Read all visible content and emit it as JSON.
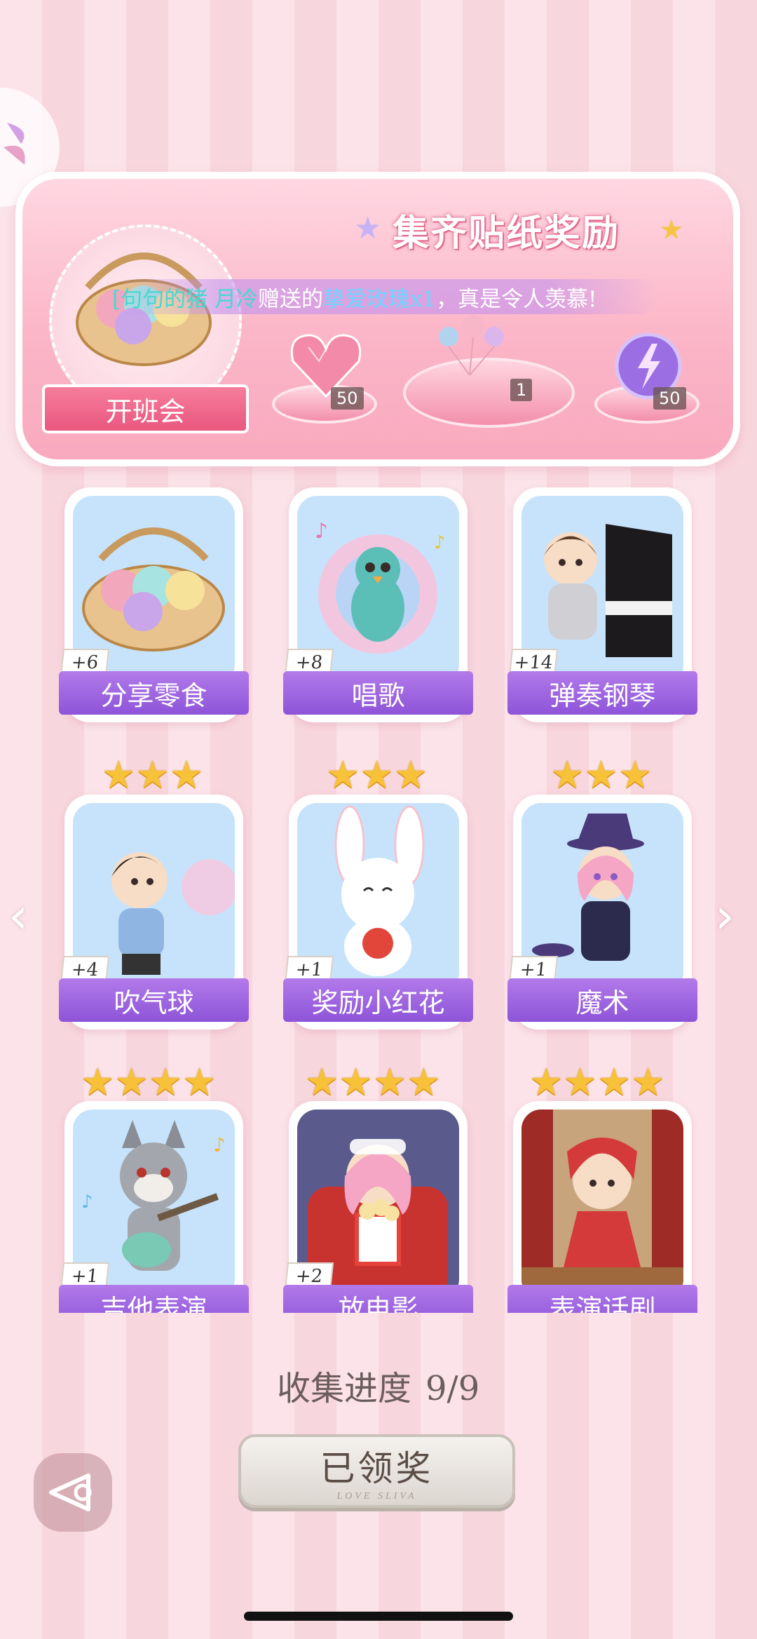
{
  "banner": {
    "title": "集齐贴纸奖励",
    "ribbon_label": "开班会",
    "notice": {
      "player_name": "[句句的猪 月冷",
      "text_mid": "赠送的",
      "item": "挚爱玫瑰x1",
      "text_end": "，真是令人羡慕!"
    },
    "rewards": [
      {
        "icon": "heart-gem-icon",
        "count": "50"
      },
      {
        "icon": "balloon-bundle-icon",
        "count": "1"
      },
      {
        "icon": "purple-lightning-orb-icon",
        "count": "50"
      }
    ]
  },
  "grid": {
    "cards": [
      {
        "label": "分享零食",
        "bonus": "+6",
        "stars": 0,
        "icon": "snack-basket-icon"
      },
      {
        "label": "唱歌",
        "bonus": "+8",
        "stars": 0,
        "icon": "singing-peacock-icon"
      },
      {
        "label": "弹奏钢琴",
        "bonus": "+14",
        "stars": 0,
        "icon": "piano-boy-icon"
      },
      {
        "label": "吹气球",
        "bonus": "+4",
        "stars": 3,
        "icon": "balloon-boy-icon"
      },
      {
        "label": "奖励小红花",
        "bonus": "+1",
        "stars": 3,
        "icon": "bunny-flower-icon"
      },
      {
        "label": "魔术",
        "bonus": "+1",
        "stars": 3,
        "icon": "magician-girl-icon"
      },
      {
        "label": "吉他表演",
        "bonus": "+1",
        "stars": 4,
        "icon": "guitar-wolf-icon"
      },
      {
        "label": "放电影",
        "bonus": "+2",
        "stars": 4,
        "icon": "popcorn-girl-icon"
      },
      {
        "label": "表演话剧",
        "bonus": "",
        "stars": 4,
        "icon": "theater-cat-girl-icon"
      }
    ]
  },
  "progress": {
    "label": "收集进度",
    "value": "9/9"
  },
  "claim_button": {
    "label": "已领奖",
    "sublabel": "LOVE SLIVA"
  },
  "colors": {
    "accent_purple": "#9a60e0",
    "banner_pink": "#f9a9bf",
    "star_gold": "#f7c23a"
  }
}
